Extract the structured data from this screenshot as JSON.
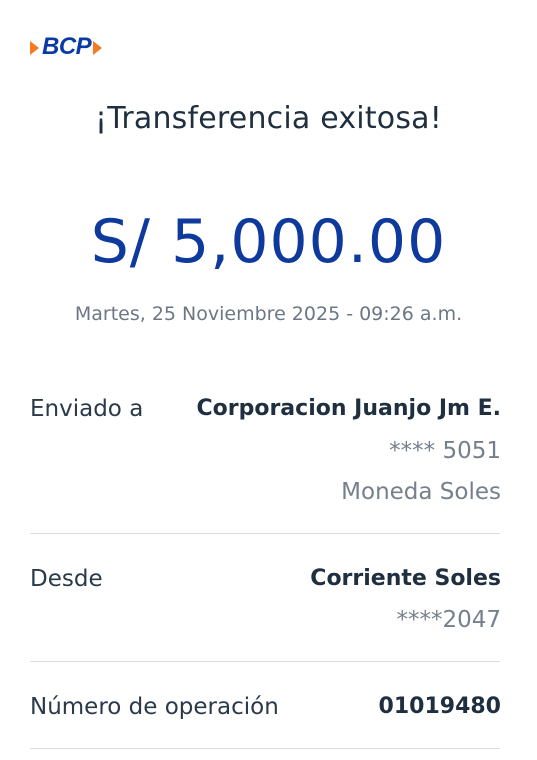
{
  "brand": {
    "logo_text": "BCP"
  },
  "header": {
    "title": "¡Transferencia exitosa!"
  },
  "transfer": {
    "amount": "S/ 5,000.00",
    "datetime": "Martes, 25 Noviembre 2025 - 09:26 a.m."
  },
  "details": {
    "sent_to": {
      "label": "Enviado a",
      "name": "Corporacion Juanjo Jm E.",
      "account": "**** 5051",
      "currency": "Moneda Soles"
    },
    "from": {
      "label": "Desde",
      "account_type": "Corriente Soles",
      "account": "****2047"
    },
    "operation": {
      "label": "Número de operación",
      "number": "01019480"
    }
  },
  "colors": {
    "brand_blue": "#0d3a9c",
    "brand_orange": "#f47b20",
    "divider": "#d9dde2"
  }
}
